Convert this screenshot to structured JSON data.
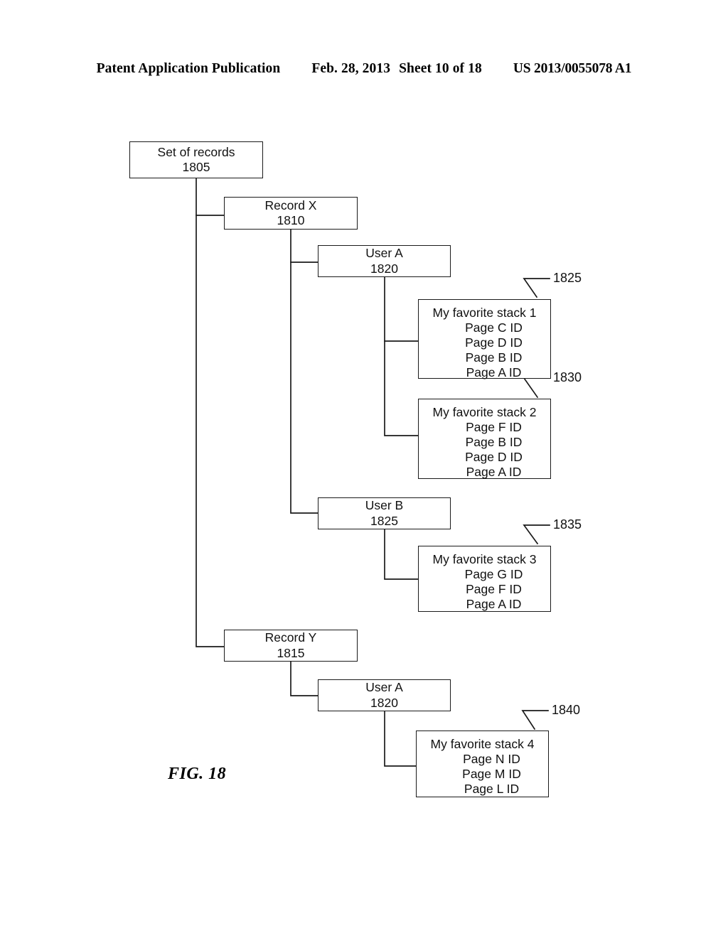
{
  "header": {
    "publication": "Patent Application Publication",
    "date": "Feb. 28, 2013",
    "sheet": "Sheet 10 of 18",
    "patent_number": "US 2013/0055078 A1"
  },
  "figure": {
    "caption": "FIG. 18"
  },
  "nodes": {
    "set_of_records": {
      "title": "Set of records",
      "ref": "1805"
    },
    "record_x": {
      "title": "Record X",
      "ref": "1810"
    },
    "user_a_1": {
      "title": "User A",
      "ref": "1820"
    },
    "user_b": {
      "title": "User B",
      "ref": "1825"
    },
    "record_y": {
      "title": "Record Y",
      "ref": "1815"
    },
    "user_a_2": {
      "title": "User A",
      "ref": "1820"
    },
    "stack1": {
      "title": "My favorite stack 1",
      "pages": [
        "Page C ID",
        "Page D ID",
        "Page B ID",
        "Page A ID"
      ],
      "ref": "1825"
    },
    "stack2": {
      "title": "My favorite stack 2",
      "pages": [
        "Page F ID",
        "Page B ID",
        "Page D ID",
        "Page A ID"
      ],
      "ref": "1830"
    },
    "stack3": {
      "title": "My favorite stack 3",
      "pages": [
        "Page G ID",
        "Page F ID",
        "Page A ID"
      ],
      "ref": "1835"
    },
    "stack4": {
      "title": "My favorite stack 4",
      "pages": [
        "Page N ID",
        "Page M ID",
        "Page L ID"
      ],
      "ref": "1840"
    }
  },
  "colors": {
    "line": "#1a1a1a",
    "text": "#111111",
    "background": "#ffffff"
  }
}
